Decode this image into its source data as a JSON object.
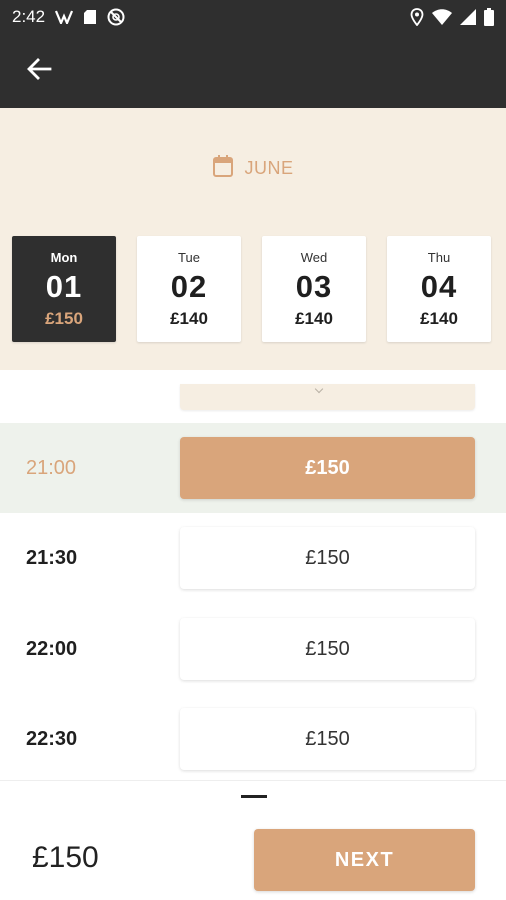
{
  "status_bar": {
    "time": "2:42",
    "icons_left": [
      "vpn-icon",
      "sim-card-icon",
      "no-disturb-icon"
    ],
    "icons_right": [
      "location-icon",
      "wifi-icon",
      "signal-icon",
      "battery-icon"
    ]
  },
  "app_bar": {
    "back_icon": "back-arrow-icon"
  },
  "header": {
    "month": "JUNE",
    "month_icon": "calendar-icon",
    "days": [
      {
        "name": "Mon",
        "number": "01",
        "price": "£150",
        "selected": true
      },
      {
        "name": "Tue",
        "number": "02",
        "price": "£140",
        "selected": false
      },
      {
        "name": "Wed",
        "number": "03",
        "price": "£140",
        "selected": false
      },
      {
        "name": "Thu",
        "number": "04",
        "price": "£140",
        "selected": false
      }
    ]
  },
  "slots": [
    {
      "time": "21:00",
      "price": "£150",
      "selected": true
    },
    {
      "time": "21:30",
      "price": "£150",
      "selected": false
    },
    {
      "time": "22:00",
      "price": "£150",
      "selected": false
    },
    {
      "time": "22:30",
      "price": "£150",
      "selected": false
    }
  ],
  "bottom": {
    "total": "£150",
    "next_label": "NEXT"
  },
  "colors": {
    "dark": "#2f2f2f",
    "accent": "#d9a57b",
    "header_bg": "#f6eee2",
    "selected_row_bg": "#eef2ec"
  }
}
